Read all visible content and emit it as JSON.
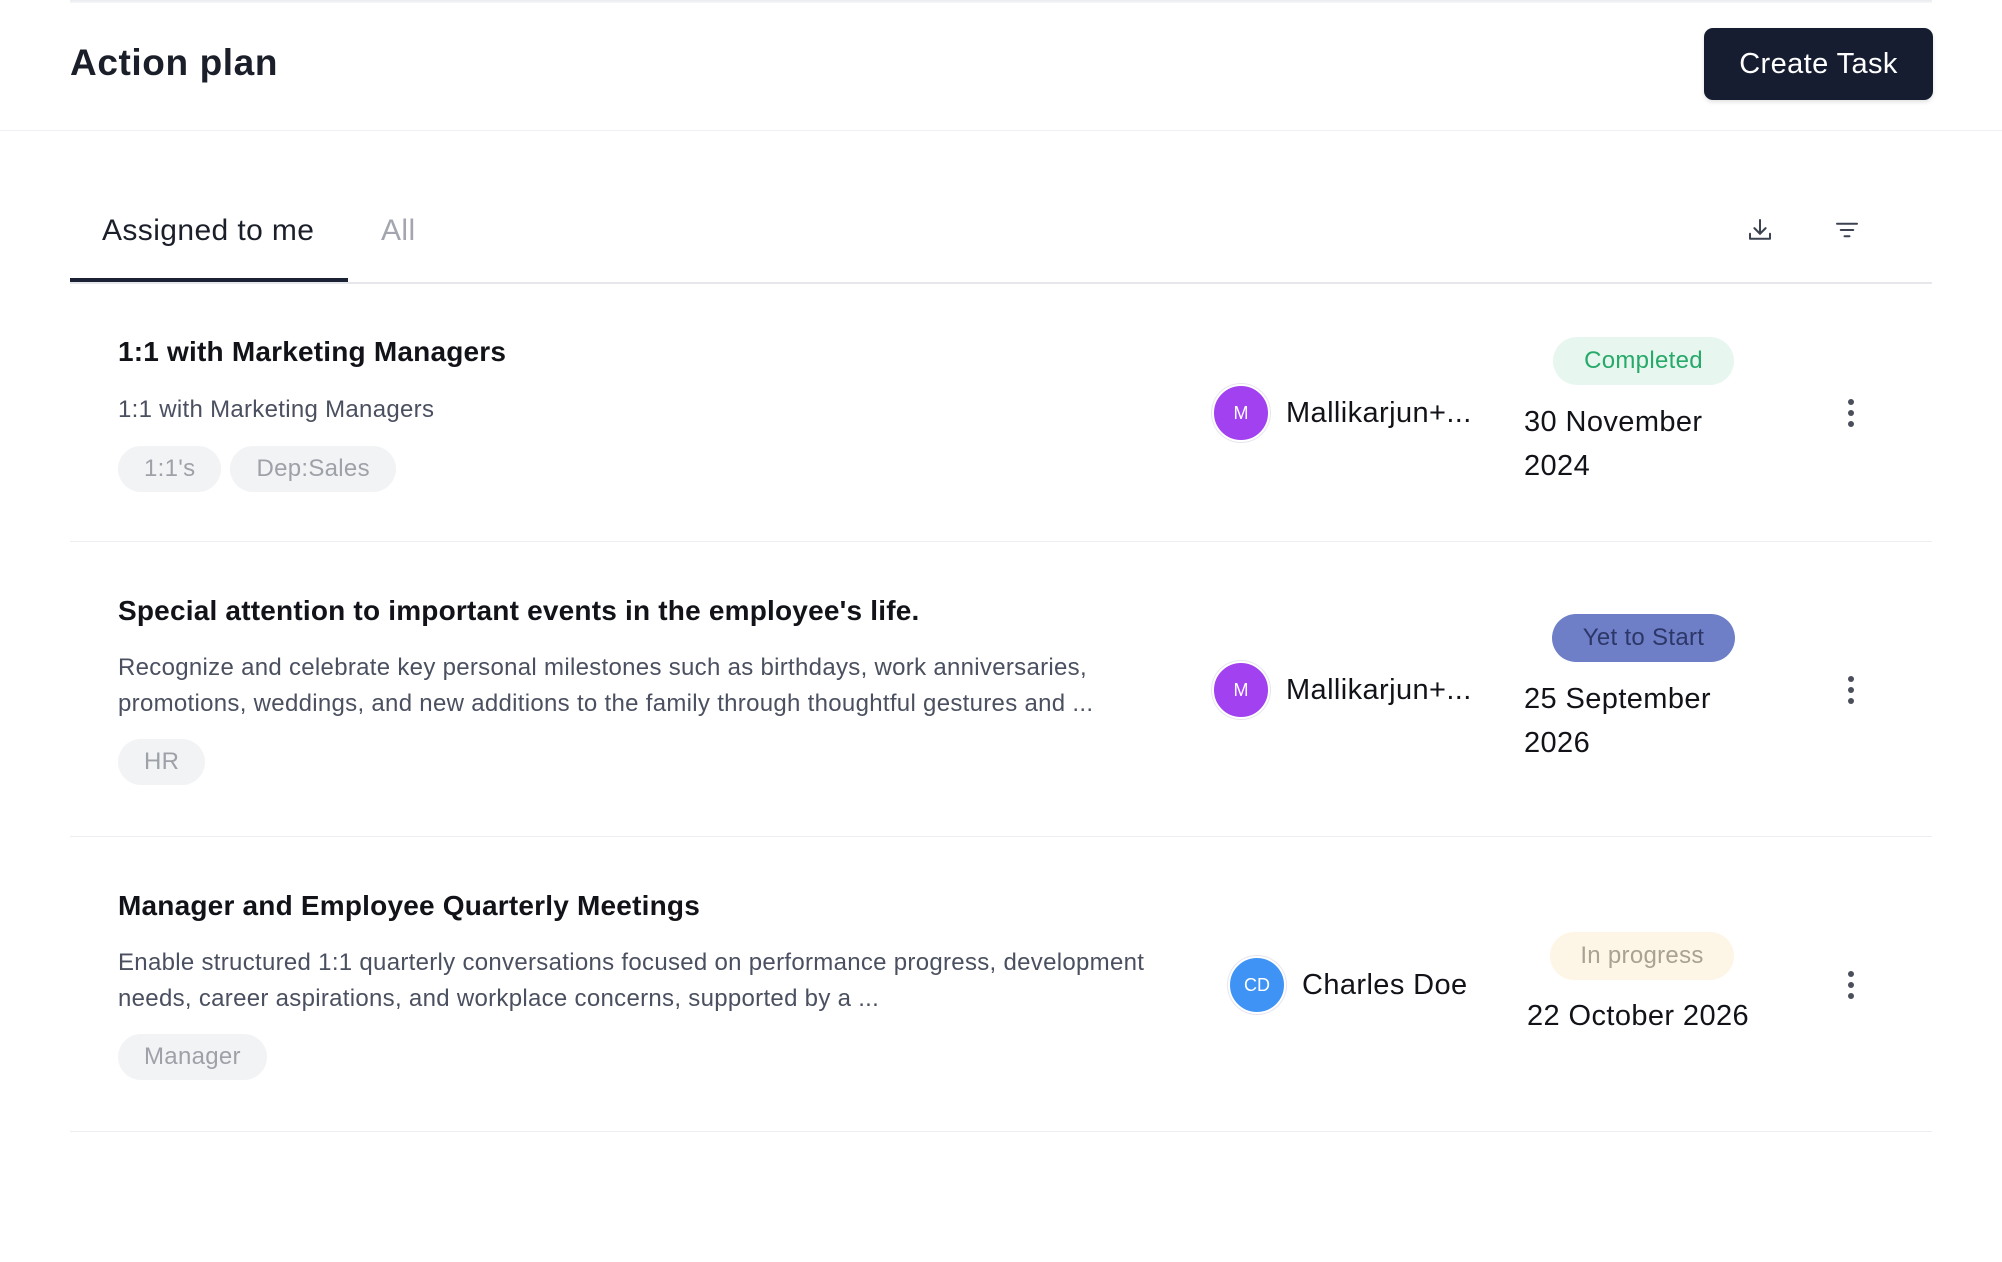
{
  "header": {
    "title": "Action plan",
    "create_button": "Create Task"
  },
  "tabs": [
    {
      "label": "Assigned to me",
      "active": true
    },
    {
      "label": "All",
      "active": false
    }
  ],
  "toolbar": {
    "download_icon": "download-icon",
    "filter_icon": "filter-icon"
  },
  "tasks": [
    {
      "title": "1:1 with Marketing Managers",
      "description": "1:1 with Marketing Managers",
      "tags": [
        "1:1's",
        "Dep:Sales"
      ],
      "assignee": {
        "initials": "M",
        "name": "Mallikarjun+...",
        "color": "#a241f0"
      },
      "status": "Completed",
      "due_date": "30 November 2024"
    },
    {
      "title": "Special attention to important events in the employee's life.",
      "description": "Recognize and celebrate key personal milestones such as birthdays, work anniversaries, promotions, weddings, and new additions to the family through thoughtful gestures and ...",
      "tags": [
        "HR"
      ],
      "assignee": {
        "initials": "M",
        "name": "Mallikarjun+...",
        "color": "#a241f0"
      },
      "status": "Yet to Start",
      "due_date": "25 September 2026"
    },
    {
      "title": "Manager and Employee Quarterly Meetings",
      "description": "Enable structured 1:1 quarterly conversations focused on performance progress, development needs, career aspirations, and workplace concerns, supported by a ...",
      "tags": [
        "Manager"
      ],
      "assignee": {
        "initials": "CD",
        "name": "Charles Doe",
        "color": "#3f93f5"
      },
      "status": "In progress",
      "due_date": "22 October 2026"
    }
  ],
  "colors": {
    "primary_button": "#161d31",
    "completed": "#27a96a",
    "yet_to_start": "#6e7fc8",
    "in_progress": "#fdf6e6"
  }
}
